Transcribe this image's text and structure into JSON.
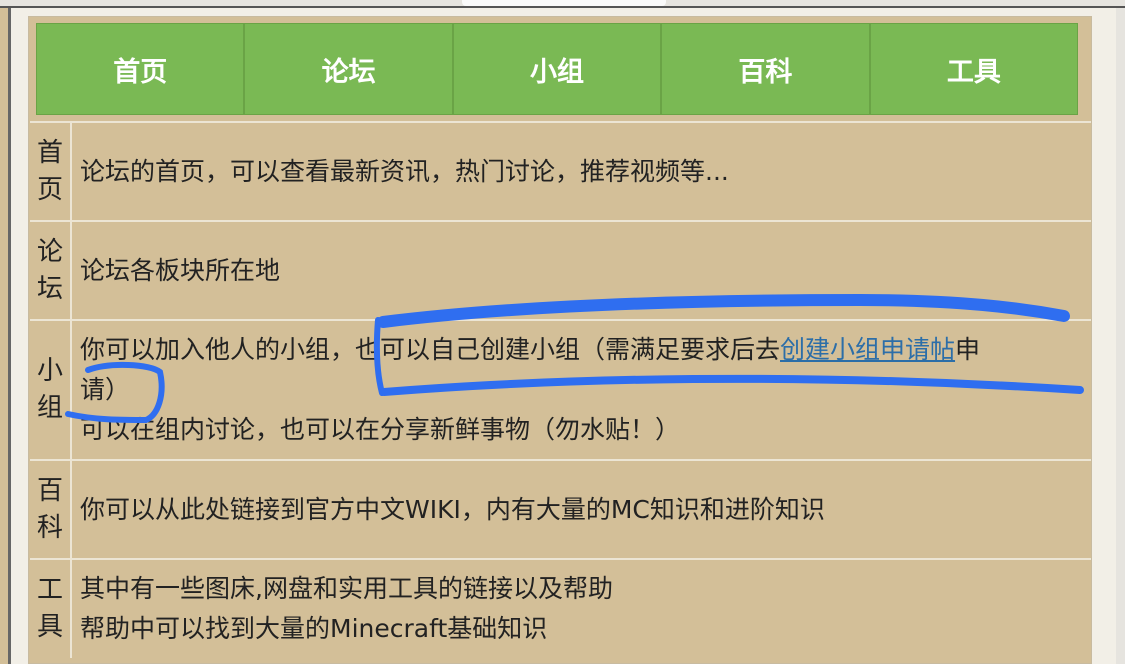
{
  "nav": {
    "items": [
      "首页",
      "论坛",
      "小组",
      "百科",
      "工具"
    ]
  },
  "rows": [
    {
      "head": [
        "首",
        "页"
      ],
      "lines": [
        "论坛的首页，可以查看最新资讯，热门讨论，推荐视频等..."
      ]
    },
    {
      "head": [
        "论",
        "坛"
      ],
      "lines": [
        "论坛各板块所在地"
      ]
    },
    {
      "head": [
        "小",
        "组"
      ],
      "line1_prefix": "你可以加入他人的小组，也可以自己创建小组（需满足要求后去",
      "line1_link": "创建小组申请帖",
      "line1_suffix": "申",
      "line2": "请）",
      "line3": "可以在组内讨论，也可以在分享新鲜事物（勿水贴！）"
    },
    {
      "head": [
        "百",
        "科"
      ],
      "lines": [
        "你可以从此处链接到官方中文WIKI，内有大量的MC知识和进阶知识"
      ]
    },
    {
      "head": [
        "工",
        "具"
      ],
      "lines": [
        "其中有一些图床,网盘和实用工具的链接以及帮助",
        "帮助中可以找到大量的Minecraft基础知识"
      ]
    }
  ],
  "colors": {
    "nav_bg": "#7ab954",
    "table_bg": "#d3bf98",
    "link": "#2c6ea8",
    "annotation": "#2f6ef0"
  }
}
